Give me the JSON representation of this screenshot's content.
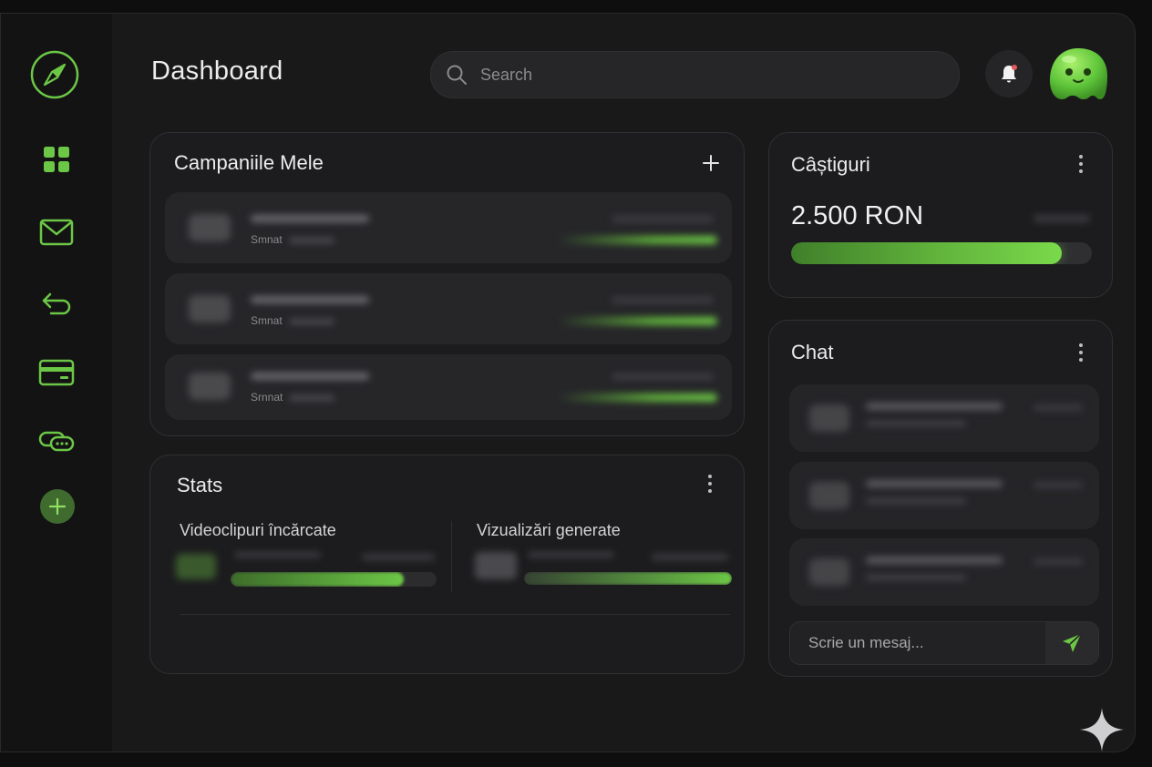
{
  "header": {
    "title": "Dashboard",
    "search_placeholder": "Search"
  },
  "sidebar": {
    "items": [
      {
        "icon": "compass-icon"
      },
      {
        "icon": "grid-icon"
      },
      {
        "icon": "mail-icon"
      },
      {
        "icon": "return-icon"
      },
      {
        "icon": "card-icon"
      },
      {
        "icon": "link-icon"
      },
      {
        "icon": "plus-icon"
      }
    ]
  },
  "campaigns": {
    "title": "Campaniile Mele",
    "items": [
      {
        "status": "Smnat"
      },
      {
        "status": "Smnat"
      },
      {
        "status": "Srnnat"
      }
    ]
  },
  "earnings": {
    "title": "Câștiguri",
    "amount": "2.500 RON",
    "progress": 0.9
  },
  "stats": {
    "title": "Stats",
    "col1_label": "Videoclipuri încărcate",
    "col2_label": "Vizualizări generate",
    "col1_progress": 0.84,
    "col2_progress": 1.0
  },
  "chat": {
    "title": "Chat",
    "input_placeholder": "Scrie un mesaj..."
  },
  "colors": {
    "accent": "#6cc746",
    "background": "#19191a",
    "card": "#1c1c1e"
  }
}
